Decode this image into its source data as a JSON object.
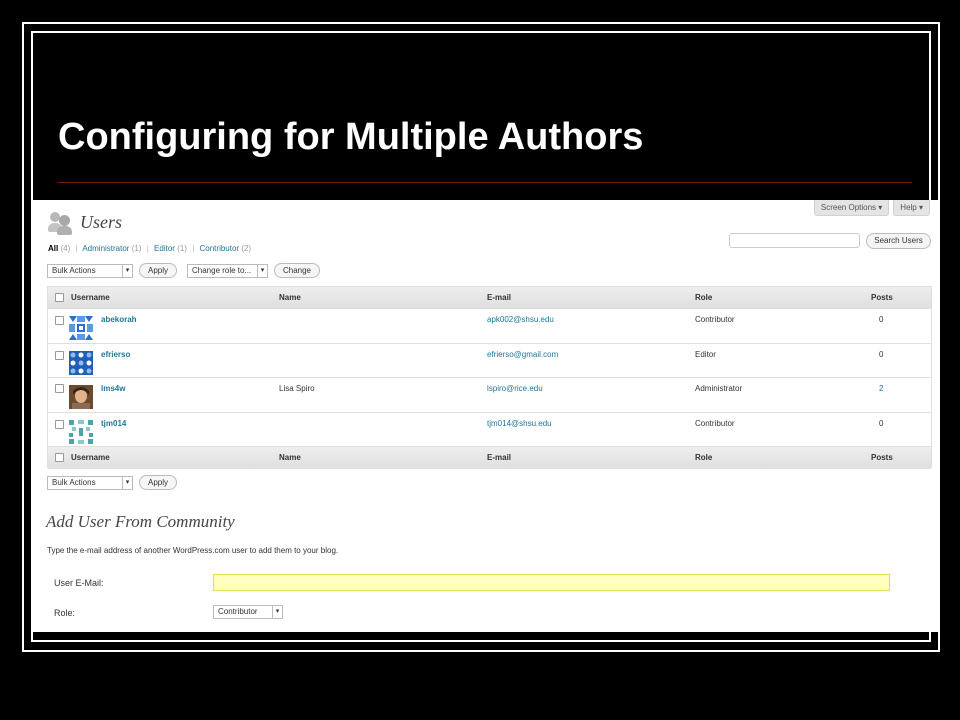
{
  "slide": {
    "title": "Configuring for Multiple Authors"
  },
  "top_tabs": [
    "Screen Options ▾",
    "Help ▾"
  ],
  "page": {
    "heading": "Users"
  },
  "filters": [
    {
      "label": "All",
      "count": "(4)",
      "current": true
    },
    {
      "label": "Administrator",
      "count": "(1)"
    },
    {
      "label": "Editor",
      "count": "(1)"
    },
    {
      "label": "Contributor",
      "count": "(2)"
    }
  ],
  "search": {
    "value": "",
    "button": "Search Users"
  },
  "bulk_actions": {
    "label": "Bulk Actions",
    "apply": "Apply"
  },
  "change_role": {
    "label": "Change role to...",
    "button": "Change"
  },
  "table": {
    "columns": [
      "Username",
      "Name",
      "E-mail",
      "Role",
      "Posts"
    ],
    "rows": [
      {
        "username": "abekorah",
        "name": "",
        "email": "apk002@shsu.edu",
        "role": "Contributor",
        "posts": "0",
        "avatar": "blue-identicon"
      },
      {
        "username": "efrierso",
        "name": "",
        "email": "efrierso@gmail.com",
        "role": "Editor",
        "posts": "0",
        "avatar": "blue-grid-identicon"
      },
      {
        "username": "lms4w",
        "name": "Lisa Spiro",
        "email": "lspiro@rice.edu",
        "role": "Administrator",
        "posts": "2",
        "avatar": "photo-avatar"
      },
      {
        "username": "tjm014",
        "name": "",
        "email": "tjm014@shsu.edu",
        "role": "Contributor",
        "posts": "0",
        "avatar": "teal-identicon"
      }
    ]
  },
  "bulk_actions_bottom": {
    "label": "Bulk Actions",
    "apply": "Apply"
  },
  "add_user": {
    "title": "Add User From Community",
    "description": "Type the e-mail address of another WordPress.com user to add them to your blog.",
    "email_label": "User E-Mail:",
    "email_value": "",
    "role_label": "Role:",
    "role_value": "Contributor"
  },
  "colors": {
    "link": "#21759b",
    "input_highlight": "#ffffc0"
  }
}
